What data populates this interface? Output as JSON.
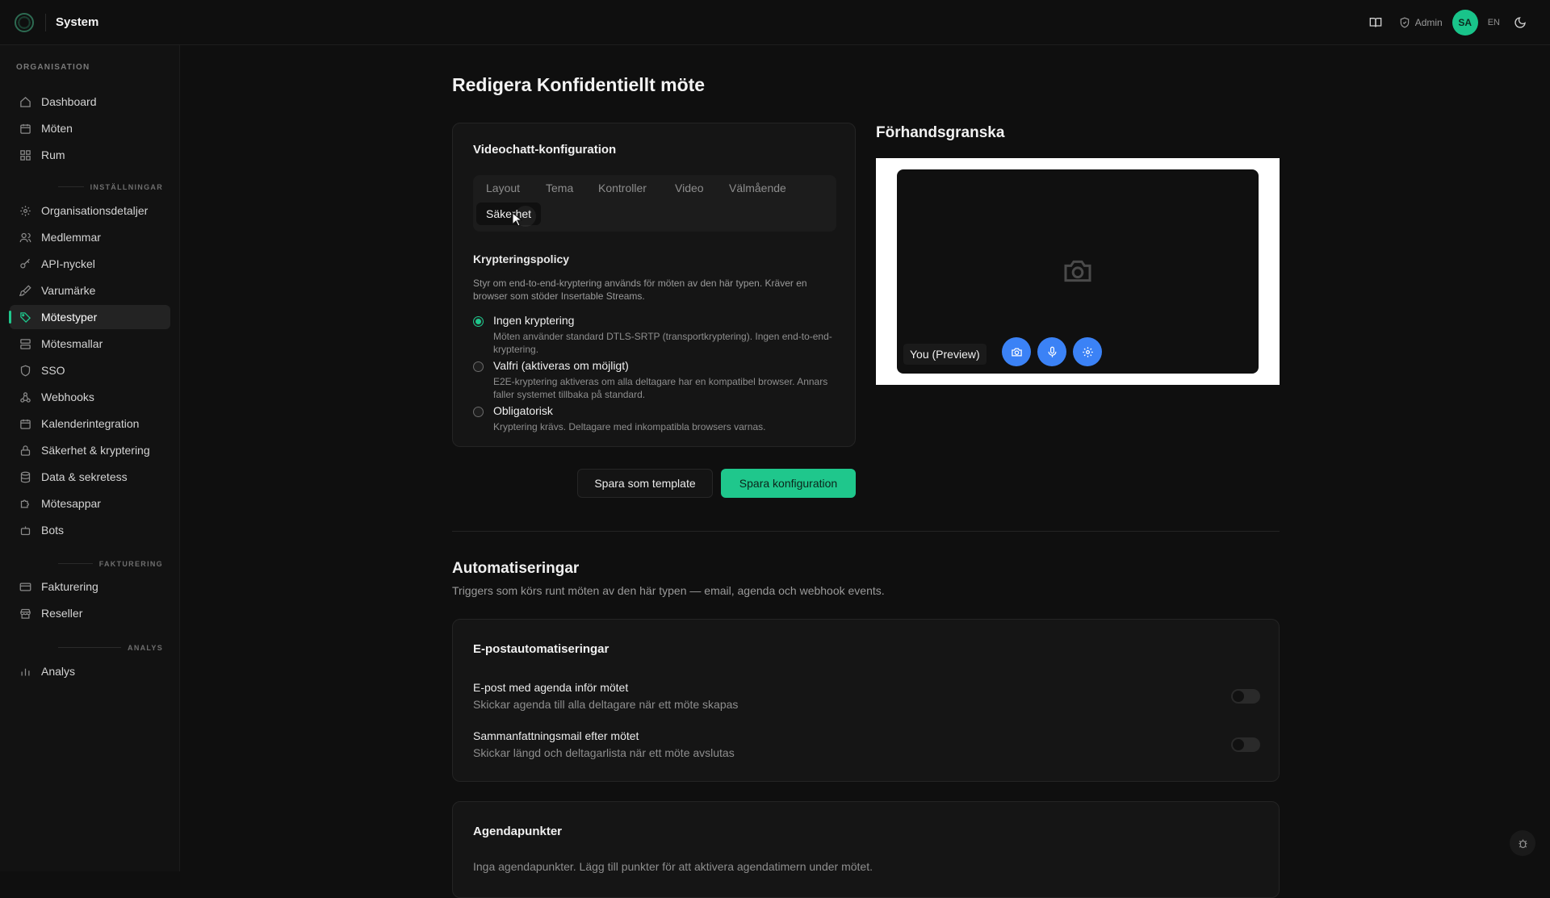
{
  "app": {
    "title": "System"
  },
  "topbar": {
    "admin_label": "Admin",
    "avatar_initials": "SA",
    "language": "EN",
    "accent": "#1fc78c"
  },
  "sidebar": {
    "sections": {
      "organisation": "ORGANISATION",
      "settings": "INSTÄLLNINGAR",
      "billing": "FAKTURERING",
      "analytics": "ANALYS"
    },
    "items": [
      {
        "label": "Dashboard",
        "icon": "home-icon"
      },
      {
        "label": "Möten",
        "icon": "calendar-icon"
      },
      {
        "label": "Rum",
        "icon": "grid-icon"
      },
      {
        "label": "Organisationsdetaljer",
        "icon": "gear-icon"
      },
      {
        "label": "Medlemmar",
        "icon": "users-icon"
      },
      {
        "label": "API-nyckel",
        "icon": "key-icon"
      },
      {
        "label": "Varumärke",
        "icon": "brush-icon"
      },
      {
        "label": "Mötestyper",
        "icon": "tag-icon",
        "active": true
      },
      {
        "label": "Mötesmallar",
        "icon": "template-icon"
      },
      {
        "label": "SSO",
        "icon": "shield-icon"
      },
      {
        "label": "Webhooks",
        "icon": "webhook-icon"
      },
      {
        "label": "Kalenderintegration",
        "icon": "calendar-icon"
      },
      {
        "label": "Säkerhet & kryptering",
        "icon": "lock-icon"
      },
      {
        "label": "Data & sekretess",
        "icon": "database-icon"
      },
      {
        "label": "Mötesappar",
        "icon": "puzzle-icon"
      },
      {
        "label": "Bots",
        "icon": "bot-icon"
      },
      {
        "label": "Fakturering",
        "icon": "card-icon"
      },
      {
        "label": "Reseller",
        "icon": "store-icon"
      },
      {
        "label": "Analys",
        "icon": "bar-chart-icon"
      }
    ]
  },
  "page": {
    "title": "Redigera Konfidentiellt möte"
  },
  "config": {
    "title": "Videochatt-konfiguration",
    "tabs": [
      "Layout",
      "Tema",
      "Kontroller",
      "Video",
      "Välmående",
      "Säkerhet"
    ],
    "active_tab": "Säkerhet",
    "encryption": {
      "title": "Krypteringspolicy",
      "description": "Styr om end-to-end-kryptering används för möten av den här typen. Kräver en browser som stöder Insertable Streams.",
      "options": [
        {
          "label": "Ingen kryptering",
          "sub": "Möten använder standard DTLS-SRTP (transportkryptering). Ingen end-to-end-kryptering.",
          "checked": true
        },
        {
          "label": "Valfri (aktiveras om möjligt)",
          "sub": "E2E-kryptering aktiveras om alla deltagare har en kompatibel browser. Annars faller systemet tillbaka på standard.",
          "checked": false
        },
        {
          "label": "Obligatorisk",
          "sub": "Kryptering krävs. Deltagare med inkompatibla browsers varnas.",
          "checked": false
        }
      ]
    },
    "save_template_label": "Spara som template",
    "save_config_label": "Spara konfiguration"
  },
  "preview": {
    "title": "Förhandsgranska",
    "you_label": "You (Preview)",
    "controls": [
      "camera-icon",
      "microphone-icon",
      "gear-icon"
    ],
    "control_color": "#3b82f6"
  },
  "automations": {
    "title": "Automatiseringar",
    "description": "Triggers som körs runt möten av den här typen — email, agenda och webhook events.",
    "email_card": {
      "title": "E-postautomatiseringar",
      "rows": [
        {
          "title": "E-post med agenda inför mötet",
          "sub": "Skickar agenda till alla deltagare när ett möte skapas",
          "enabled": false
        },
        {
          "title": "Sammanfattningsmail efter mötet",
          "sub": "Skickar längd och deltagarlista när ett möte avslutas",
          "enabled": false
        }
      ]
    },
    "agenda_card": {
      "title": "Agendapunkter",
      "empty_text": "Inga agendapunkter. Lägg till punkter för att aktivera agendatimern under mötet."
    }
  }
}
